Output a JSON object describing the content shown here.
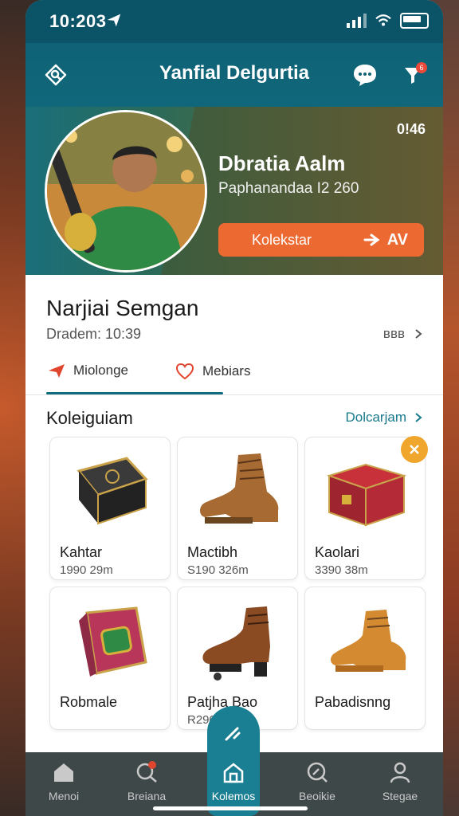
{
  "status": {
    "time": "10:203"
  },
  "header": {
    "title": "Yanfial Delgurtia",
    "notif_badge": "6"
  },
  "hero": {
    "count": "0!46",
    "name": "Dbratia Aalm",
    "subtitle": "Paphanandaa I2 260",
    "cta_label": "Kolekstar",
    "cta_right": "AV"
  },
  "profile": {
    "name": "Narjiai Semgan",
    "date": "Dradem: 10:39",
    "more_label": "ʙʙʙ",
    "tabs": [
      {
        "label": "Miolonge"
      },
      {
        "label": "Mebiars"
      }
    ]
  },
  "section": {
    "title": "Koleiguiam",
    "link": "Dolcarjam"
  },
  "products": [
    {
      "name": "Kahtar",
      "price": "1990 29m",
      "icon": "book-icon"
    },
    {
      "name": "Mactibh",
      "price": "S190 326m",
      "icon": "boot-icon"
    },
    {
      "name": "Kaolari",
      "price": "3390 38m",
      "icon": "chest-icon"
    },
    {
      "name": "Robmale",
      "price": "",
      "icon": "trunk-icon"
    },
    {
      "name": "Patjha Bao",
      "price": "R290",
      "icon": "shoe-icon"
    },
    {
      "name": "Pabadisnng",
      "price": "",
      "icon": "boot-icon"
    }
  ],
  "nav": [
    {
      "label": "Menoi"
    },
    {
      "label": "Breiana"
    },
    {
      "label": "Kolemos"
    },
    {
      "label": "Beoikie"
    },
    {
      "label": "Stegae"
    }
  ],
  "colors": {
    "primary": "#0f6c7d",
    "accent": "#ec6a32",
    "badge": "#f0a62c",
    "nav": "#3f4849"
  }
}
